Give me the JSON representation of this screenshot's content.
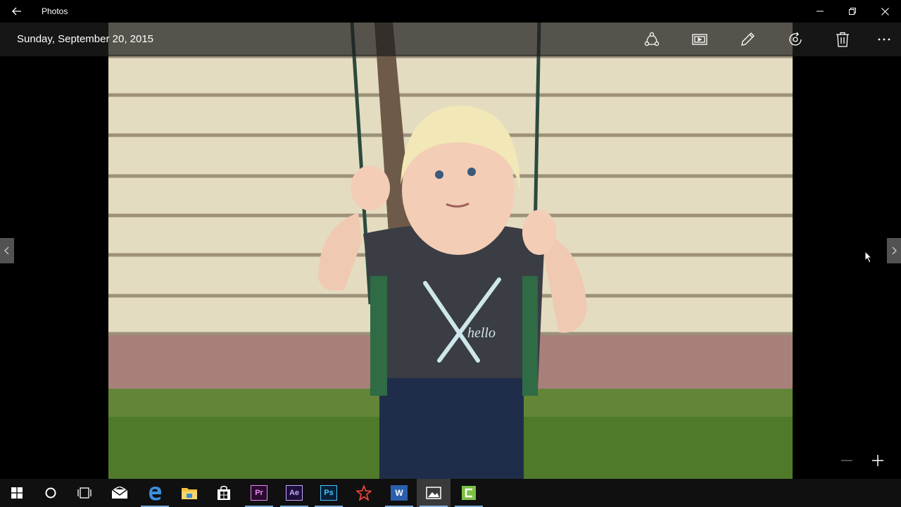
{
  "app": {
    "title": "Photos"
  },
  "photo": {
    "date": "Sunday, September 20, 2015",
    "shirt_text": "hello"
  },
  "toolbar": {
    "commands": [
      "share-icon",
      "slideshow-icon",
      "edit-icon",
      "rotate-icon",
      "delete-icon",
      "more-icon"
    ]
  },
  "taskbar": {
    "items": [
      "start",
      "cortana",
      "task-view",
      "mail",
      "edge",
      "file-explorer",
      "store",
      "premiere",
      "after-effects",
      "photoshop",
      "app-red-star",
      "word",
      "photos",
      "camtasia"
    ],
    "premiere_label": "Pr",
    "after_effects_label": "Ae",
    "photoshop_label": "Ps",
    "word_label": "W"
  },
  "colors": {
    "accent": "#7aa7d8",
    "titlebar": "#000000",
    "taskbar": "#101010"
  }
}
